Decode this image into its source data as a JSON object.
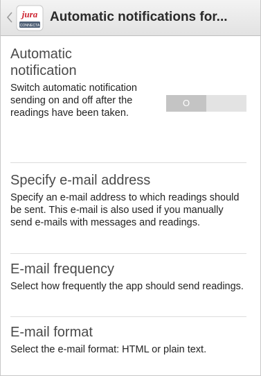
{
  "header": {
    "title": "Automatic notifications for...",
    "logo_text": "jura",
    "logo_subtext": "CONNECTA"
  },
  "sections": [
    {
      "title": "Automatic notification",
      "description": "Switch automatic notification sending on and off after the readings have been taken.",
      "toggle": {
        "label": "O",
        "state": "off"
      }
    },
    {
      "title": "Specify e-mail address",
      "description": "Specify an e-mail address to which readings should be sent. This e-mail is also used if you manually send e-mails with messages and readings."
    },
    {
      "title": "E-mail frequency",
      "description": "Select how frequently the app should send readings."
    },
    {
      "title": "E-mail format",
      "description": "Select the e-mail format: HTML or plain text."
    }
  ],
  "colors": {
    "logo_red": "#cc1f2c",
    "toggle_off": "#c4c4c4"
  }
}
